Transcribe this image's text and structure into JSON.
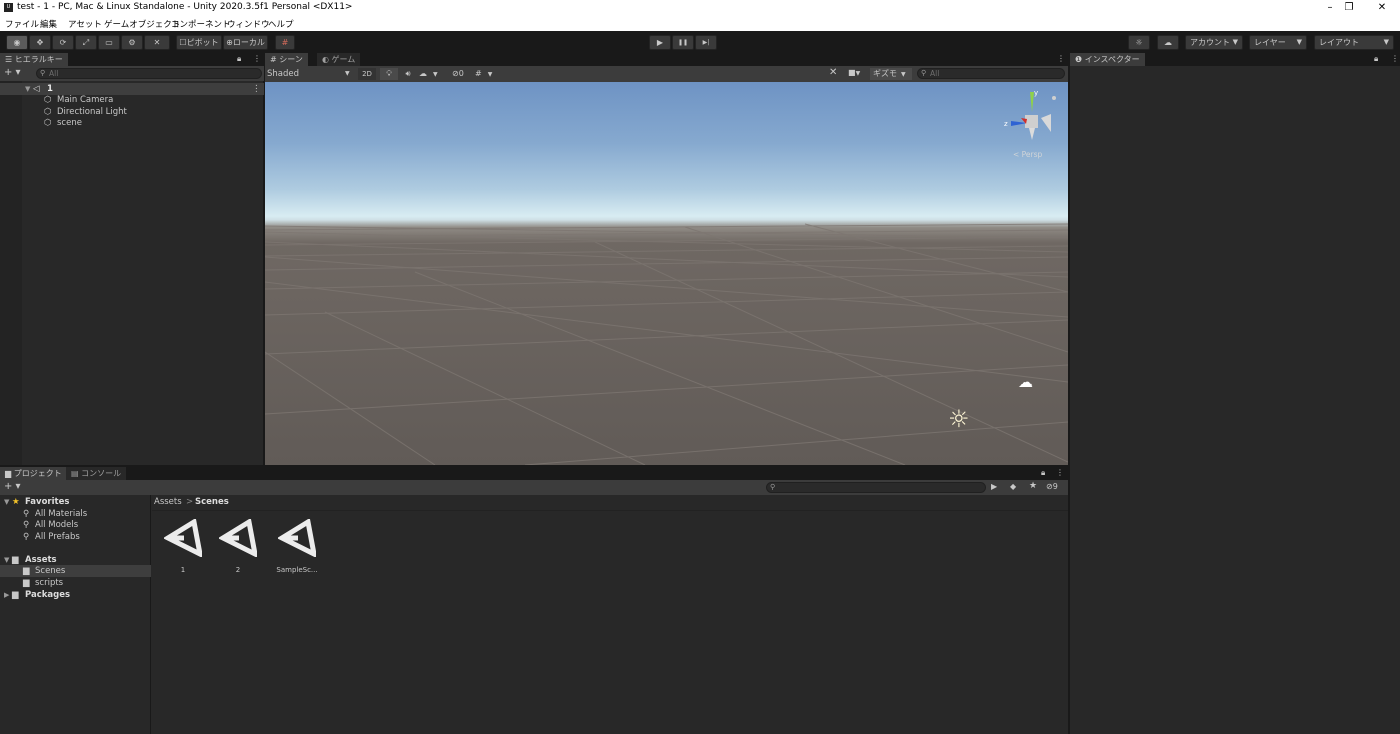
{
  "window": {
    "title": "test - 1 - PC, Mac & Linux Standalone - Unity 2020.3.5f1 Personal <DX11>",
    "app_icon_label": "U",
    "controls": {
      "minimize": "–",
      "restore": "❐",
      "close": "✕"
    }
  },
  "menubar": [
    "ファイル",
    "編集",
    "アセット",
    "ゲームオブジェクト",
    "コンポーネント",
    "ウィンドウ",
    "ヘルプ"
  ],
  "toolbar": {
    "tools": [
      "◉",
      "✥",
      "⟳",
      "⤢",
      "▭",
      "⚙",
      "✕"
    ],
    "pivot_label": "ピボット",
    "local_label": "ローカル",
    "grid_snap_icon": "#",
    "play": "▶",
    "pause": "❚❚",
    "step": "▶|",
    "account_label": "アカウント",
    "layers_label": "レイヤー",
    "layout_label": "レイアウト"
  },
  "hierarchy": {
    "tab_label": "ヒエラルキー",
    "add_label": "+ ▾",
    "search_placeholder": "All",
    "scene_name": "1",
    "items": [
      "Main Camera",
      "Directional Light",
      "scene"
    ]
  },
  "scene_view": {
    "tabs": [
      "シーン",
      "ゲーム"
    ],
    "shading_mode": "Shaded",
    "mode_2d": "2D",
    "hidden_count": "0",
    "gizmos_label": "ギズモ",
    "search_placeholder": "All",
    "axis_labels": {
      "y": "y",
      "z": "z"
    },
    "persp_label": "< Persp"
  },
  "inspector": {
    "tab_label": "インスペクター"
  },
  "project": {
    "tabs": [
      "プロジェクト",
      "コンソール"
    ],
    "add_label": "+ ▾",
    "hidden_count": "9",
    "favorites_label": "Favorites",
    "favorites": [
      "All Materials",
      "All Models",
      "All Prefabs"
    ],
    "assets_label": "Assets",
    "asset_folders": [
      "Scenes",
      "scripts"
    ],
    "packages_label": "Packages",
    "breadcrumb": [
      "Assets",
      "Scenes"
    ],
    "breadcrumb_sep": ">",
    "files": [
      "1",
      "2",
      "SampleSc..."
    ]
  },
  "colors": {
    "editor_bg": "#282828",
    "toolbar_bg": "#191919",
    "selection": "#3e3e3e",
    "accent_yellow": "#f4c329",
    "active_tab": "#3c3c3c"
  }
}
